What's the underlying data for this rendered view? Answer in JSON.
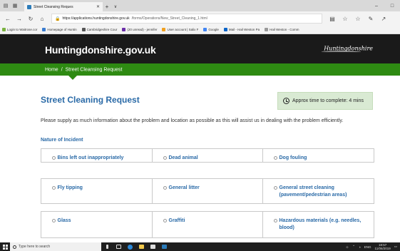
{
  "browser": {
    "tab_title": "Street Cleansing Reques",
    "url_host": "https://applications.huntingdonshire.gov.uk",
    "url_path": "/forms/Operations/New_Street_Cleaning_1.html",
    "favorites": [
      {
        "label": "Login to Waitrose.cor",
        "color": "#7bb241"
      },
      {
        "label": "Homepage of Huntin",
        "color": "#3a7ccf"
      },
      {
        "label": "Cambridgeshire Cour",
        "color": "#555555"
      },
      {
        "label": "(20 unread) - jennifer",
        "color": "#6b2fa8"
      },
      {
        "label": "User account | Salix F",
        "color": "#f0a020"
      },
      {
        "label": "Google",
        "color": "#4285f4"
      },
      {
        "label": "Mail - Hail Weston Pa",
        "color": "#0a64c8"
      },
      {
        "label": "Hail Weston - Comm",
        "color": "#999999"
      }
    ]
  },
  "site": {
    "name": "Huntingdonshire.gov.uk",
    "logo_text": "Huntingdonshire"
  },
  "breadcrumb": {
    "home": "Home",
    "separator": "/",
    "current": "Street Cleansing Request"
  },
  "main": {
    "title": "Street Cleaning Request",
    "time_note": "Approx time to complete: 4 mins",
    "intro": "Please supply as much information about the problem and location as possible as this will assist us in dealing with the problem efficiently.",
    "section_label": "Nature of Incident",
    "options": [
      [
        "Bins left out inappropriately",
        "Dead animal",
        "Dog fouling"
      ],
      [
        "Fly tipping",
        "General litter",
        "General street cleaning (pavement/pedestrian areas)"
      ],
      [
        "Glass",
        "Graffiti",
        "Hazardous materials (e.g. needles, blood)"
      ]
    ]
  },
  "taskbar": {
    "search_placeholder": "Type here to search",
    "language": "ENG",
    "time": "18:57",
    "date": "11/06/2019"
  }
}
